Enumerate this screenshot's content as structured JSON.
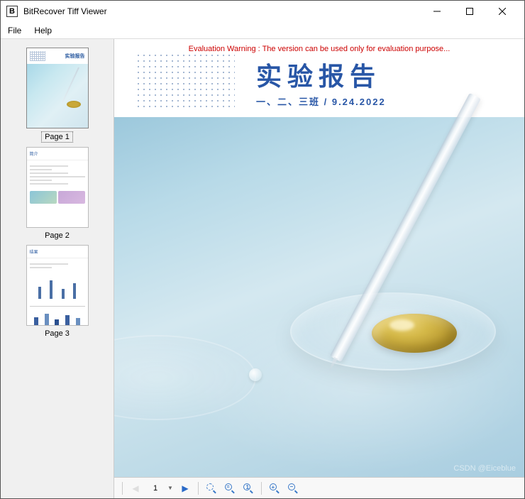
{
  "window": {
    "title": "BitRecover Tiff Viewer"
  },
  "menu": {
    "file": "File",
    "help": "Help"
  },
  "sidebar": {
    "pages": [
      {
        "label": "Page 1"
      },
      {
        "label": "Page 2"
      },
      {
        "label": "Page 3"
      }
    ]
  },
  "document": {
    "eval_warning": "Evaluation Warning : The version can be used only for evaluation purpose...",
    "title": "实验报告",
    "subtitle": "一、二、三班  /  9.24.2022"
  },
  "toolbar": {
    "current_page": "1"
  },
  "watermark": "CSDN @Eiceblue"
}
